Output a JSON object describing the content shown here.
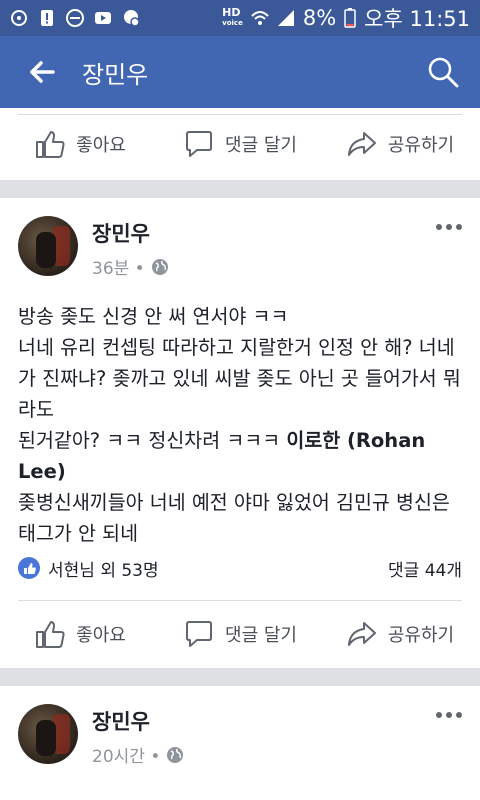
{
  "status_bar": {
    "hd_label": "HD",
    "voice_label": "voice",
    "battery": "8%",
    "time": "오후 11:51"
  },
  "app_bar": {
    "title": "장민우",
    "back_icon": "arrow-left-icon",
    "search_icon": "search-icon"
  },
  "actions": {
    "like": "좋아요",
    "comment": "댓글 달기",
    "share": "공유하기"
  },
  "posts": [
    {
      "author": "장민우",
      "time": "36분 •",
      "body_pre": "방송 좆도 신경 안 써 연서야 ㅋㅋ\n너네 유리 컨셉팅 따라하고 지랄한거 인정 안 해? 너네가 진짜냐? 좆까고 있네 씨발 좆도 아닌 곳 들어가서 뭐라도\n된거같아? ㅋㅋ 정신차려 ㅋㅋㅋ ",
      "tag": "이로한 (Rohan Lee)",
      "body_post": "\n좆병신새끼들아 너네 예전 야마 잃었어 김민규 병신은 태그가 안 되네",
      "likes": "서현님 외 53명",
      "comments": "댓글 44개"
    },
    {
      "author": "장민우",
      "time": "20시간 •"
    }
  ],
  "colors": {
    "status_bar": "#3b5998",
    "app_bar": "#4267b2",
    "background": "#dfe0e4",
    "like_badge": "#4a76d8"
  }
}
